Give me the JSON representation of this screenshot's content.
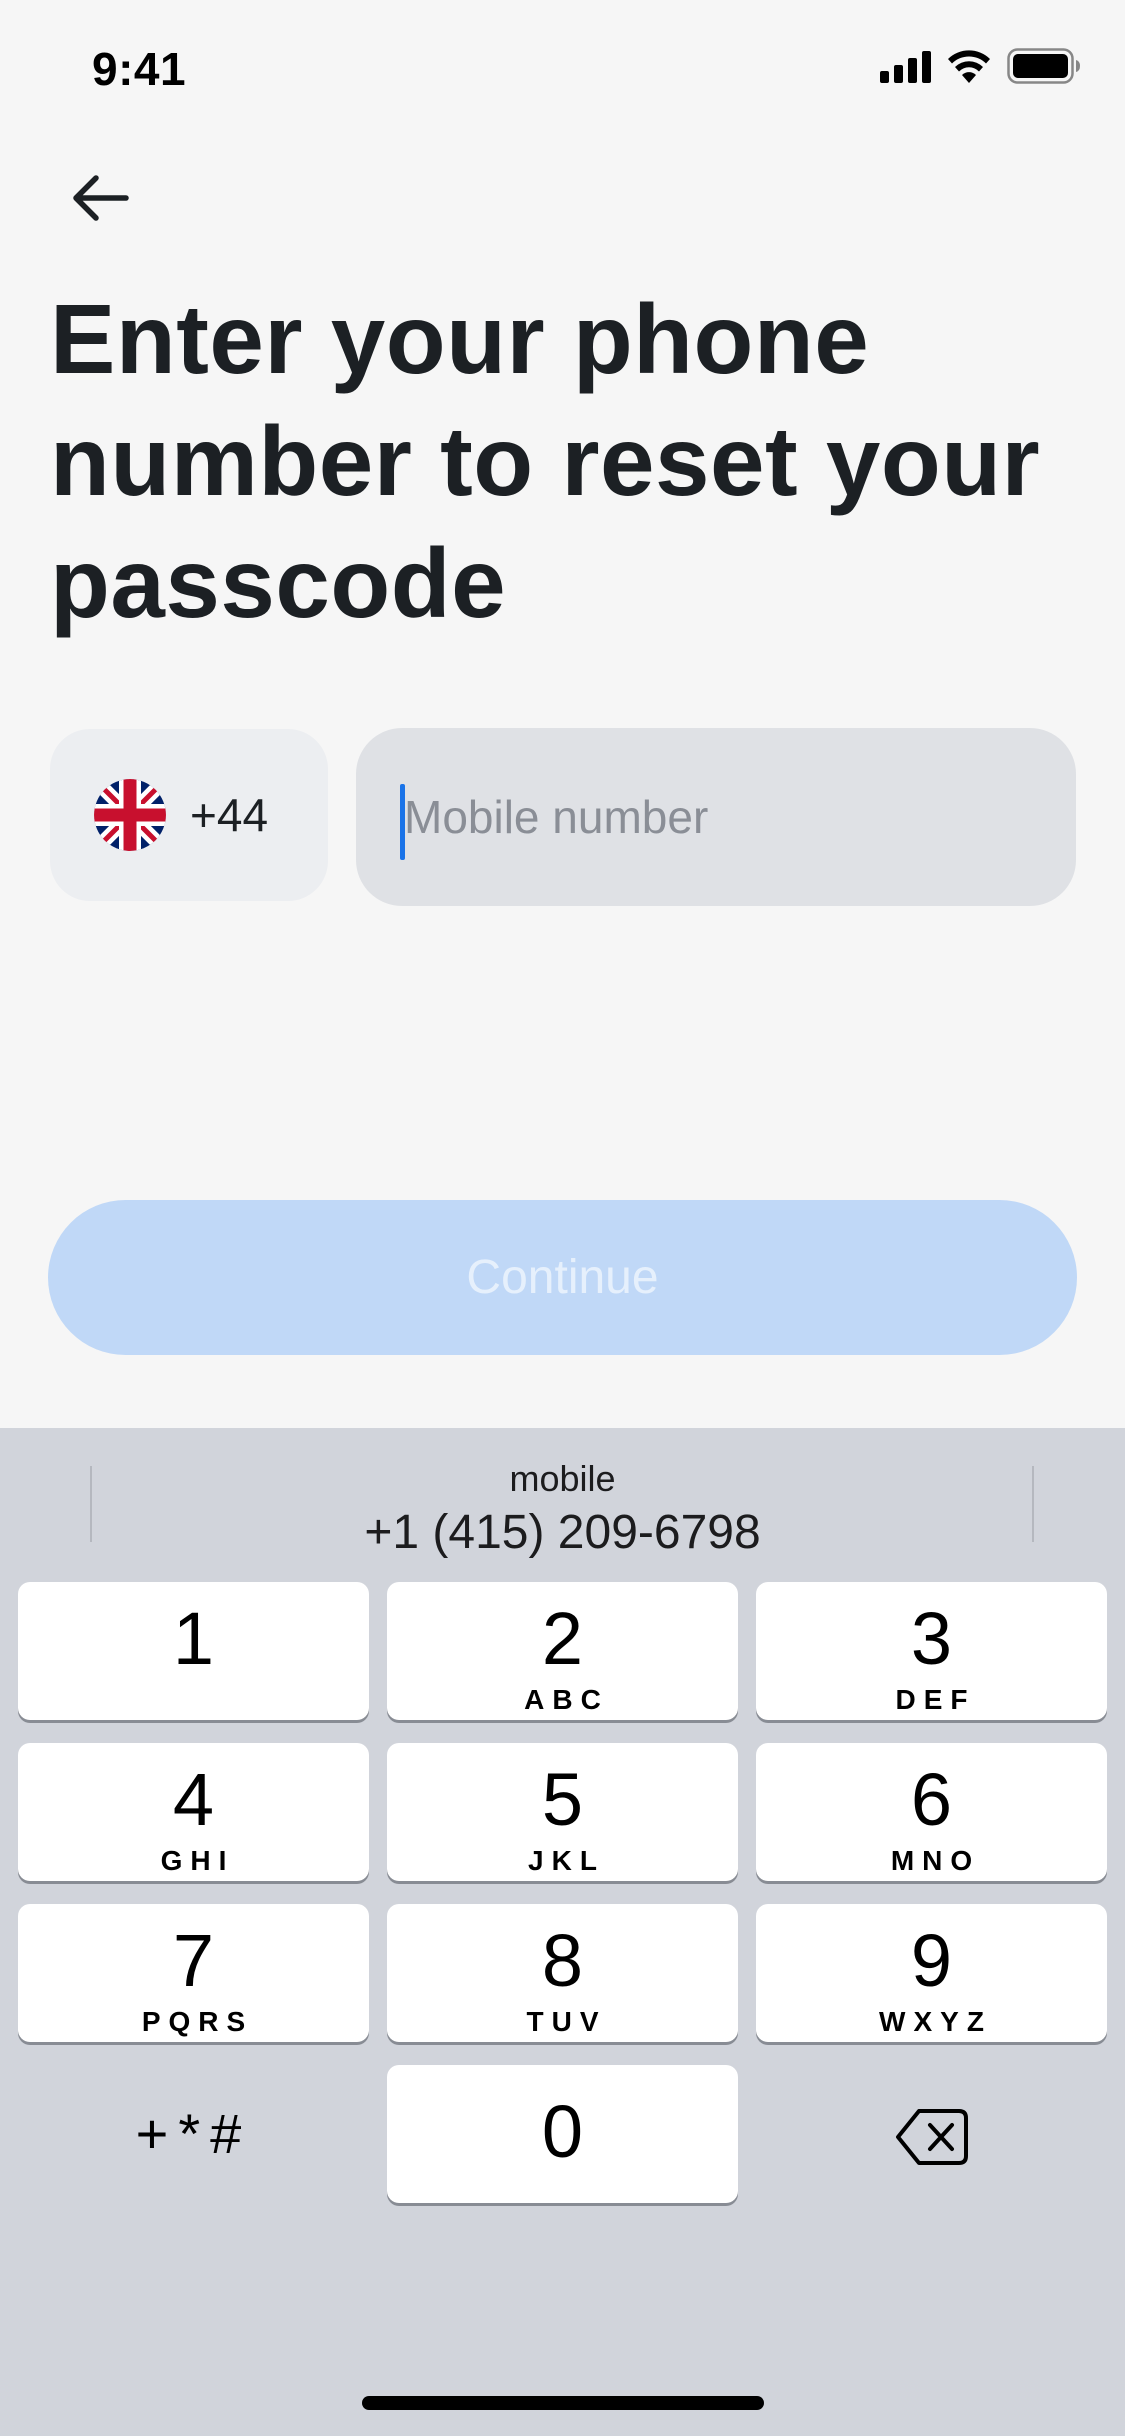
{
  "status_bar": {
    "time": "9:41",
    "icons": [
      "signal-icon",
      "wifi-icon",
      "battery-icon"
    ]
  },
  "header": {
    "back_icon": "arrow-left-icon",
    "title": "Enter your phone number to reset your passcode"
  },
  "phone_form": {
    "country": {
      "flag_icon": "uk-flag-icon",
      "dial_code": "+44"
    },
    "mobile_input": {
      "value": "",
      "placeholder": "Mobile number"
    }
  },
  "continue_button": {
    "label": "Continue",
    "enabled": false
  },
  "keyboard": {
    "suggestion": {
      "label": "mobile",
      "number": "+1 (415) 209-6798"
    },
    "keys": [
      {
        "digit": "1",
        "letters": ""
      },
      {
        "digit": "2",
        "letters": "ABC"
      },
      {
        "digit": "3",
        "letters": "DEF"
      },
      {
        "digit": "4",
        "letters": "GHI"
      },
      {
        "digit": "5",
        "letters": "JKL"
      },
      {
        "digit": "6",
        "letters": "MNO"
      },
      {
        "digit": "7",
        "letters": "PQRS"
      },
      {
        "digit": "8",
        "letters": "TUV"
      },
      {
        "digit": "9",
        "letters": "WXYZ"
      },
      {
        "digit": "0",
        "letters": ""
      }
    ],
    "symbols_label": "+*#",
    "delete_icon": "backspace-icon"
  },
  "colors": {
    "background": "#f6f6f6",
    "accent": "#1a73e8",
    "continue_disabled": "#c0d8f7",
    "keyboard_bg": "#d1d4db"
  }
}
